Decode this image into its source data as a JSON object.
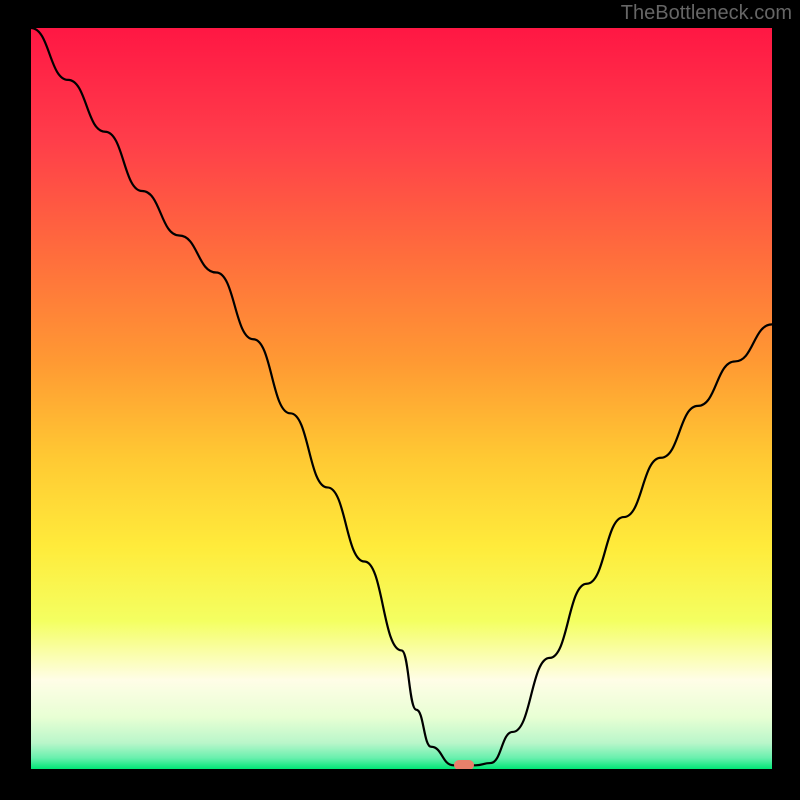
{
  "watermark": "TheBottleneck.com",
  "chart_data": {
    "type": "line",
    "title": "",
    "xlabel": "",
    "ylabel": "",
    "xlim": [
      0,
      100
    ],
    "ylim": [
      0,
      100
    ],
    "x": [
      0,
      5,
      10,
      15,
      20,
      25,
      30,
      35,
      40,
      45,
      50,
      52,
      54,
      57,
      60,
      62,
      65,
      70,
      75,
      80,
      85,
      90,
      95,
      100
    ],
    "y": [
      100,
      93,
      86,
      78,
      72,
      67,
      58,
      48,
      38,
      28,
      16,
      8,
      3,
      0.5,
      0.5,
      0.8,
      5,
      15,
      25,
      34,
      42,
      49,
      55,
      60
    ],
    "marker": {
      "x": 58.5,
      "y": 0.5
    },
    "gradient_stops": [
      {
        "pos": 0,
        "color": "#ff1744"
      },
      {
        "pos": 0.15,
        "color": "#ff3d4a"
      },
      {
        "pos": 0.3,
        "color": "#ff6b3d"
      },
      {
        "pos": 0.45,
        "color": "#ff9933"
      },
      {
        "pos": 0.58,
        "color": "#ffc933"
      },
      {
        "pos": 0.7,
        "color": "#ffeb3b"
      },
      {
        "pos": 0.8,
        "color": "#f4ff61"
      },
      {
        "pos": 0.88,
        "color": "#fffde7"
      },
      {
        "pos": 0.93,
        "color": "#e8ffd4"
      },
      {
        "pos": 0.965,
        "color": "#b9f6ca"
      },
      {
        "pos": 0.985,
        "color": "#69f0ae"
      },
      {
        "pos": 1.0,
        "color": "#00e676"
      }
    ]
  }
}
